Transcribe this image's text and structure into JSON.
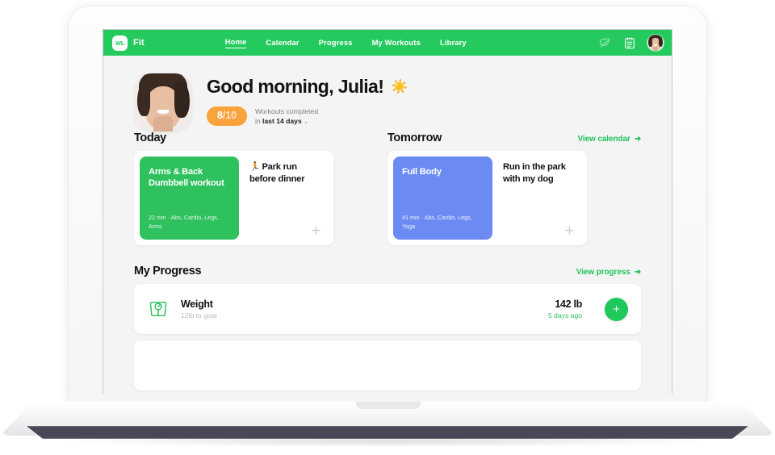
{
  "nav": {
    "brand_logo_text": "WL",
    "brand_name": "Fit",
    "links": [
      {
        "label": "Home",
        "active": true
      },
      {
        "label": "Calendar",
        "active": false
      },
      {
        "label": "Progress",
        "active": false
      },
      {
        "label": "My Workouts",
        "active": false
      },
      {
        "label": "Library",
        "active": false
      }
    ],
    "icons": [
      {
        "name": "leaf-icon"
      },
      {
        "name": "clipboard-icon"
      },
      {
        "name": "user-avatar"
      }
    ]
  },
  "greeting": {
    "title": "Good morning, Julia!",
    "emoji": "☀️",
    "badge_value": "8",
    "badge_total": "/10",
    "sub_line1": "Workouts completed",
    "sub_line2_prefix": "in ",
    "sub_line2_strong": "last 14 days",
    "chevron": "⌄"
  },
  "today": {
    "heading": "Today",
    "workout": {
      "title": "Arms & Back Dumbbell workout",
      "meta": "22 min · Abs, Cardio, Legs, Arms",
      "color": "#2ec15e"
    },
    "note": {
      "emoji": "🏃",
      "title": "Park run before dinner"
    },
    "add_label": "+"
  },
  "tomorrow": {
    "heading": "Tomorrow",
    "link_label": "View calendar",
    "link_arrow": "➜",
    "workout": {
      "title": "Full Body",
      "meta": "41 min · Abs, Cardio, Legs, Yoga",
      "color": "#6b8bf2"
    },
    "note": {
      "emoji": "",
      "title": "Run in the park with my dog"
    },
    "add_label": "+"
  },
  "progress": {
    "heading": "My Progress",
    "link_label": "View progress",
    "link_arrow": "➜",
    "rows": [
      {
        "icon": "scale-icon",
        "name": "Weight",
        "sub": "12lb to goal",
        "value": "142 lb",
        "when": "5 days ago",
        "add_label": "+"
      }
    ]
  },
  "colors": {
    "brand_green": "#25ca5f",
    "accent_green": "#2ec15e",
    "accent_orange": "#f9a33c",
    "accent_blue": "#6b8bf2",
    "page_bg": "#f4f4f4"
  }
}
